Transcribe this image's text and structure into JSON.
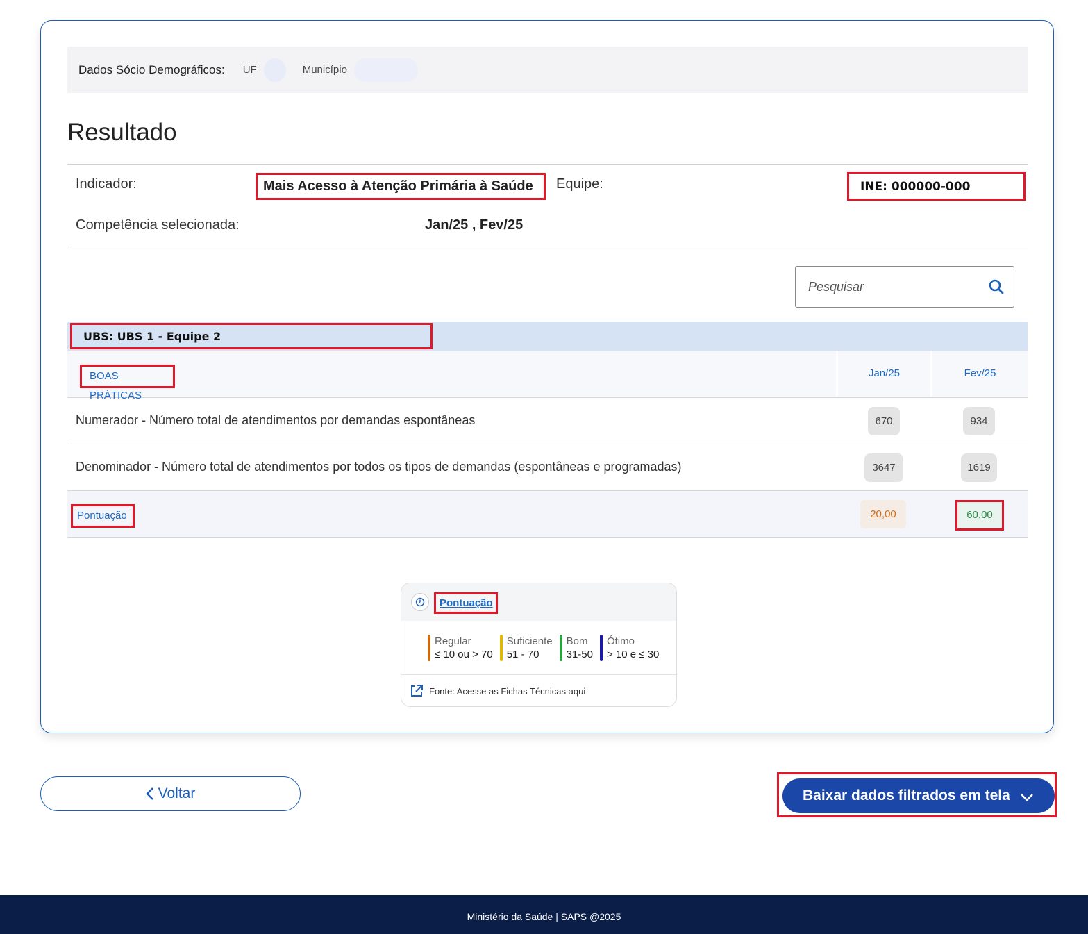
{
  "socio": {
    "label": "Dados Sócio Demográficos:",
    "uf_label": "UF",
    "municipio_label": "Município"
  },
  "result": {
    "title": "Resultado"
  },
  "info": {
    "indicador_label": "Indicador:",
    "indicador_value": "Mais Acesso à Atenção Primária à Saúde",
    "equipe_label": "Equipe:",
    "equipe_value": "INE: 000000-000",
    "competencia_label": "Competência selecionada:",
    "competencia_value": "Jan/25 , Fev/25"
  },
  "search": {
    "placeholder": "Pesquisar",
    "icon": "search-icon"
  },
  "ubs": {
    "label": "UBS: UBS 1 - Equipe 2"
  },
  "table": {
    "section_label": "BOAS PRÁTICAS",
    "months": [
      "Jan/25",
      "Fev/25"
    ],
    "rows": [
      {
        "label": "Numerador - Número total de atendimentos por demandas espontâneas",
        "values": [
          "670",
          "934"
        ]
      },
      {
        "label": "Denominador - Número total de atendimentos por todos os tipos de demandas (espontâneas e programadas)",
        "values": [
          "3647",
          "1619"
        ]
      }
    ],
    "score": {
      "label": "Pontuação",
      "values": [
        "20,00",
        "60,00"
      ],
      "colors": [
        "#d36b12",
        "#2a8b48"
      ]
    }
  },
  "legend": {
    "title": "Pontuação",
    "items": [
      {
        "name": "Regular",
        "range": "≤ 10 ou > 70",
        "color": "#c96a12"
      },
      {
        "name": "Suficiente",
        "range": "51 - 70",
        "color": "#e0b800"
      },
      {
        "name": "Bom",
        "range": "31-50",
        "color": "#2ea043"
      },
      {
        "name": "Ótimo",
        "range": "> 10 e ≤ 30",
        "color": "#1a1aa8"
      }
    ],
    "source": "Fonte: Acesse as Fichas Técnicas aqui"
  },
  "buttons": {
    "voltar": "Voltar",
    "download": "Baixar dados filtrados em tela"
  },
  "footer": {
    "text": "Ministério da Saúde | SAPS @2025"
  }
}
